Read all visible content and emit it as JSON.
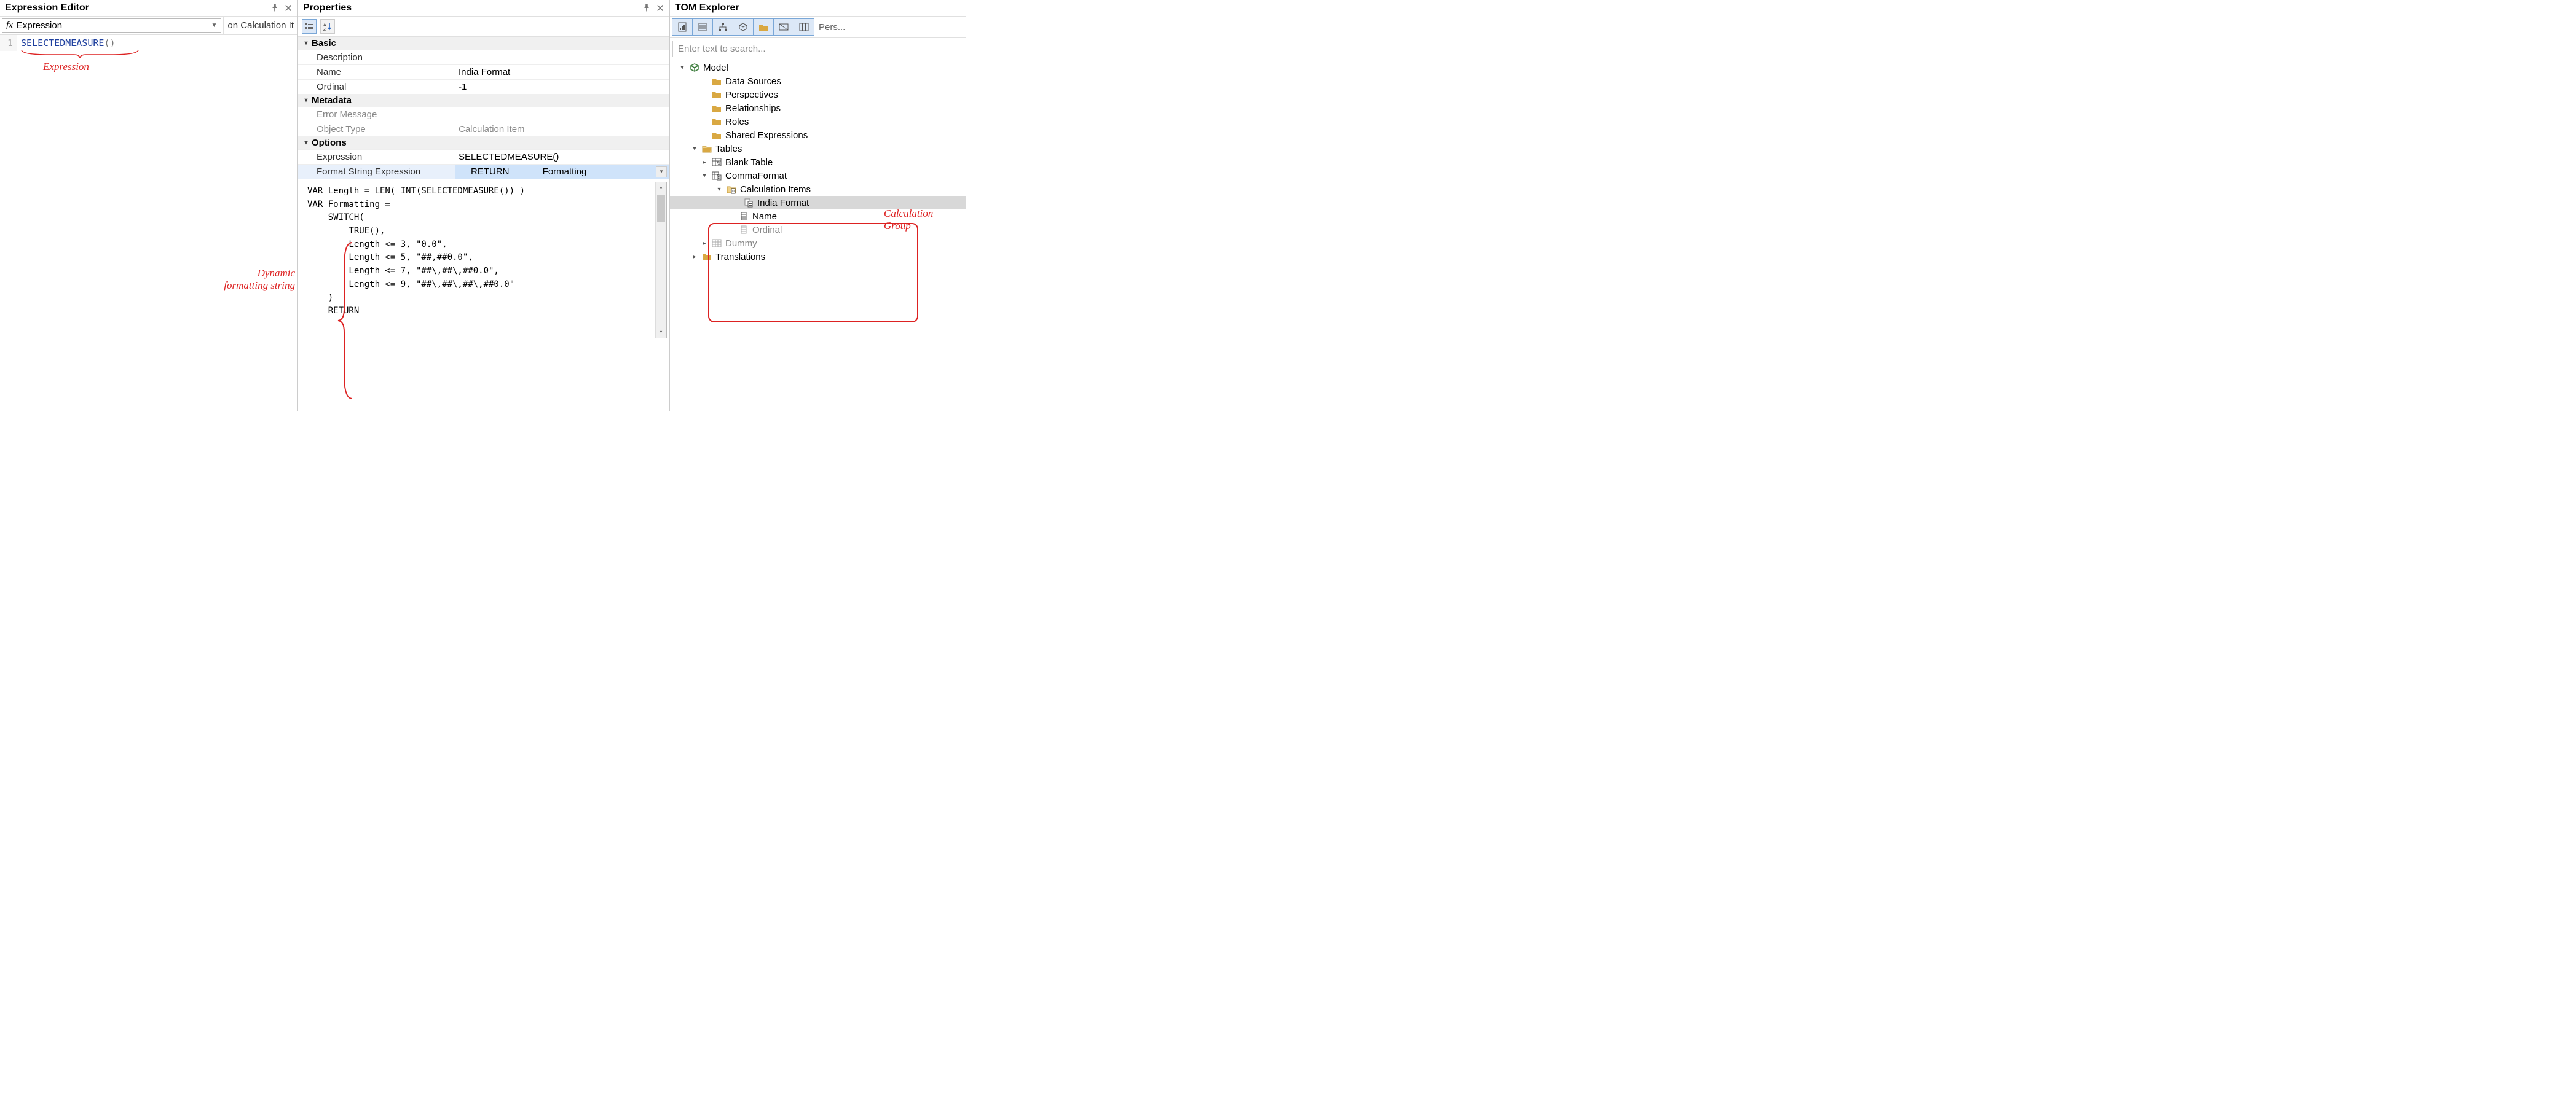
{
  "expression_editor": {
    "title": "Expression Editor",
    "dropdown_label": "Expression",
    "context_label": "on Calculation It",
    "line_no": "1",
    "code_kw": "SELECTEDMEASURE",
    "code_paren": "()",
    "annotation": "Expression"
  },
  "properties": {
    "title": "Properties",
    "cats": {
      "basic": "Basic",
      "metadata": "Metadata",
      "options": "Options"
    },
    "basic": {
      "description_label": "Description",
      "description_value": "",
      "name_label": "Name",
      "name_value": "India Format",
      "ordinal_label": "Ordinal",
      "ordinal_value": "-1"
    },
    "metadata": {
      "error_label": "Error Message",
      "error_value": "",
      "objtype_label": "Object Type",
      "objtype_value": "Calculation Item"
    },
    "options": {
      "expr_label": "Expression",
      "expr_value": "SELECTEDMEASURE()",
      "fse_label": "Format String Expression",
      "fse_mid": "RETURN",
      "fse_right": "Formatting"
    },
    "editor_text": "VAR Length = LEN( INT(SELECTEDMEASURE()) )\nVAR Formatting =\n    SWITCH(\n        TRUE(),\n        Length <= 3, \"0.0\",\n        Length <= 5, \"##,##0.0\",\n        Length <= 7, \"##\\,##\\,##0.0\",\n        Length <= 9, \"##\\,##\\,##\\,##0.0\"\n    )\n    RETURN",
    "annotation_line1": "Dynamic",
    "annotation_line2": "formatting string"
  },
  "tom": {
    "title": "TOM Explorer",
    "pers": "Pers...",
    "search_placeholder": "Enter text to search...",
    "tree": {
      "model": "Model",
      "data_sources": "Data Sources",
      "perspectives": "Perspectives",
      "relationships": "Relationships",
      "roles": "Roles",
      "shared_expr": "Shared Expressions",
      "tables": "Tables",
      "blank_table": "Blank Table",
      "comma_format": "CommaFormat",
      "calc_items": "Calculation Items",
      "india_format": "India Format",
      "name": "Name",
      "ordinal": "Ordinal",
      "dummy": "Dummy",
      "translations": "Translations"
    },
    "annotation_line1": "Calculation",
    "annotation_line2": "Group"
  }
}
